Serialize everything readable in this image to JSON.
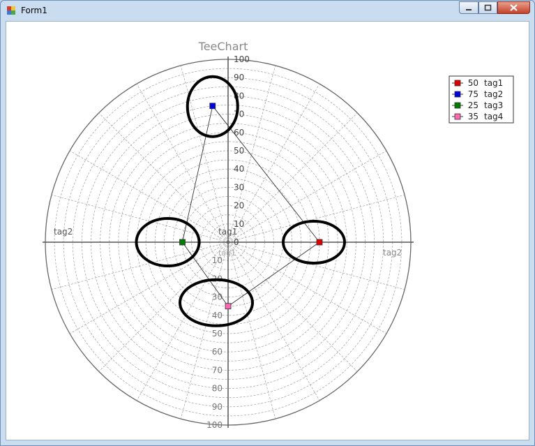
{
  "window": {
    "title": "Form1"
  },
  "chart": {
    "title": "TeeChart",
    "angle_labels": {
      "right": "tag2",
      "left": "tag2",
      "center_upper": "tag1",
      "center_lower": "tag1"
    },
    "radial_axis_labels": {
      "up": [
        "0",
        "10",
        "20",
        "30",
        "40",
        "50",
        "60",
        "70",
        "80",
        "90",
        "100"
      ],
      "down": [
        "0",
        "10",
        "20",
        "30",
        "40",
        "50",
        "60",
        "70",
        "80",
        "90",
        "100"
      ]
    },
    "colors": {
      "tag1": "#e00000",
      "tag2": "#0000e0",
      "tag3": "#007a00",
      "tag4": "#ff69b4",
      "line": "#333333",
      "annotation": "#000000"
    }
  },
  "chart_data": {
    "type": "scatter",
    "title": "TeeChart",
    "rlim": [
      0,
      100
    ],
    "grid": true,
    "legend_position": "top-right",
    "points": [
      {
        "name": "tag1",
        "value": 50,
        "angle_deg": 0,
        "color": "#e00000"
      },
      {
        "name": "tag2",
        "value": 75,
        "angle_deg": 96.5,
        "color": "#0000e0"
      },
      {
        "name": "tag3",
        "value": 25,
        "angle_deg": 180,
        "color": "#007a00"
      },
      {
        "name": "tag4",
        "value": 35,
        "angle_deg": 270,
        "color": "#ff69b4"
      }
    ],
    "legend": [
      {
        "value": "50",
        "label": "tag1",
        "color": "#e00000"
      },
      {
        "value": "75",
        "label": "tag2",
        "color": "#0000e0"
      },
      {
        "value": "25",
        "label": "tag3",
        "color": "#007a00"
      },
      {
        "value": "35",
        "label": "tag4",
        "color": "#ff69b4"
      }
    ]
  }
}
